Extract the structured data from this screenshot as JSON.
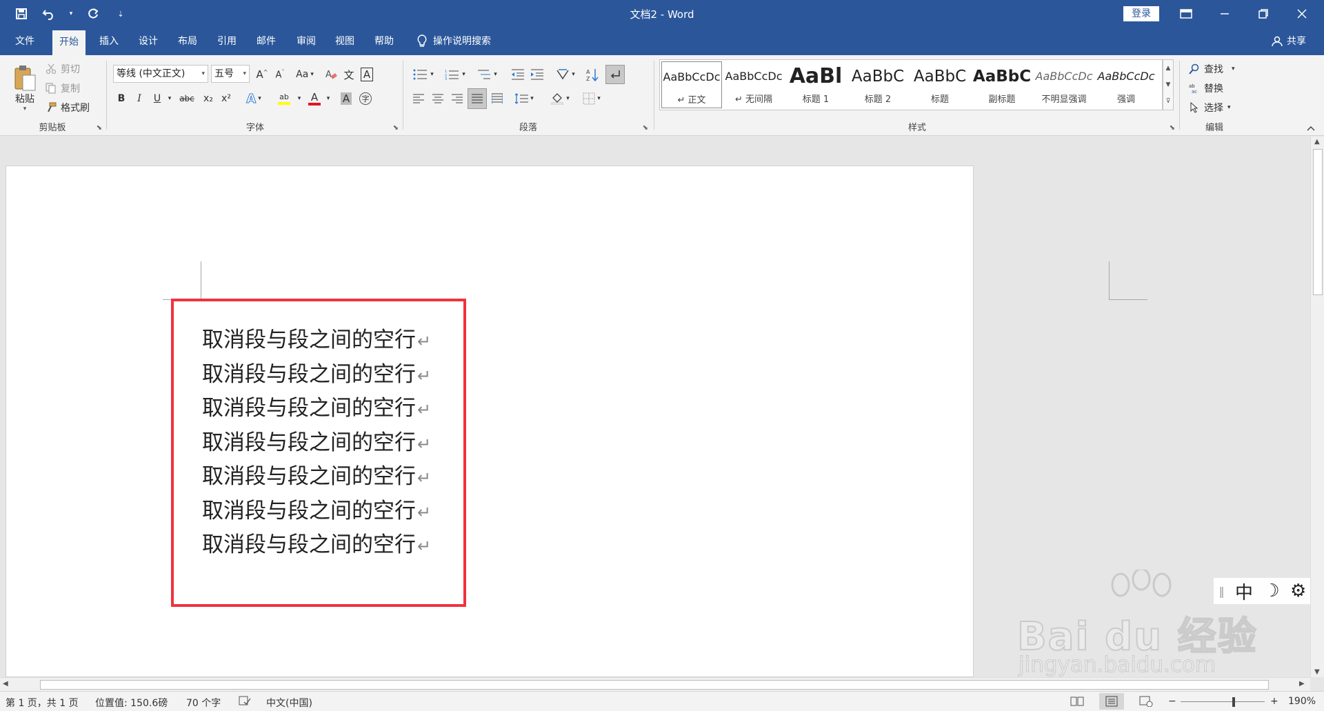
{
  "titlebar": {
    "doc_title": "文档2  -  Word",
    "login": "登录",
    "qat_customize": "⇣"
  },
  "tabs": [
    {
      "label": "文件"
    },
    {
      "label": "开始"
    },
    {
      "label": "插入"
    },
    {
      "label": "设计"
    },
    {
      "label": "布局"
    },
    {
      "label": "引用"
    },
    {
      "label": "邮件"
    },
    {
      "label": "审阅"
    },
    {
      "label": "视图"
    },
    {
      "label": "帮助"
    }
  ],
  "tellme": "操作说明搜索",
  "share": "共享",
  "clipboard": {
    "paste": "粘贴",
    "cut": "剪切",
    "copy": "复制",
    "format_painter": "格式刷",
    "label": "剪贴板"
  },
  "font": {
    "name": "等线 (中文正文)",
    "size": "五号",
    "label": "字体",
    "change_case": "Aa",
    "bold": "B",
    "italic": "I",
    "underline": "U",
    "strike": "abc",
    "subscript": "x₂",
    "superscript": "x²",
    "wen_button": "文",
    "border_char": "A",
    "effects_char": "A",
    "highlight_char": "ab",
    "fontcolor_char": "A",
    "shade_char": "A",
    "enclose_char": "字"
  },
  "paragraph": {
    "label": "段落"
  },
  "styles": {
    "label": "样式",
    "items": [
      {
        "preview": "AaBbCcDc",
        "name": "↵ 正文"
      },
      {
        "preview": "AaBbCcDc",
        "name": "↵ 无间隔"
      },
      {
        "preview": "AaBl",
        "name": "标题 1"
      },
      {
        "preview": "AaBbC",
        "name": "标题 2"
      },
      {
        "preview": "AaBbC",
        "name": "标题"
      },
      {
        "preview": "AaBbC",
        "name": "副标题"
      },
      {
        "preview": "AaBbCcDc",
        "name": "不明显强调"
      },
      {
        "preview": "AaBbCcDc",
        "name": "强调"
      }
    ]
  },
  "editing": {
    "find": "查找",
    "replace": "替换",
    "select": "选择",
    "label": "编辑"
  },
  "document": {
    "paragraphs": [
      "取消段与段之间的空行",
      "取消段与段之间的空行",
      "取消段与段之间的空行",
      "取消段与段之间的空行",
      "取消段与段之间的空行",
      "取消段与段之间的空行",
      "取消段与段之间的空行"
    ],
    "paragraph_mark": "↵"
  },
  "ime": {
    "mode": "中"
  },
  "watermark": {
    "main": "Bai du 经验",
    "sub": "jingyan.baidu.com"
  },
  "status": {
    "page": "第 1 页，共 1 页",
    "position": "位置值: 150.6磅",
    "words": "70 个字",
    "language": "中文(中国)",
    "zoom": "190%"
  },
  "colors": {
    "accent": "#2b579a",
    "highlight_box": "#f0323c",
    "font_color_bar": "#e81123",
    "highlight_bar": "#ffff00"
  }
}
